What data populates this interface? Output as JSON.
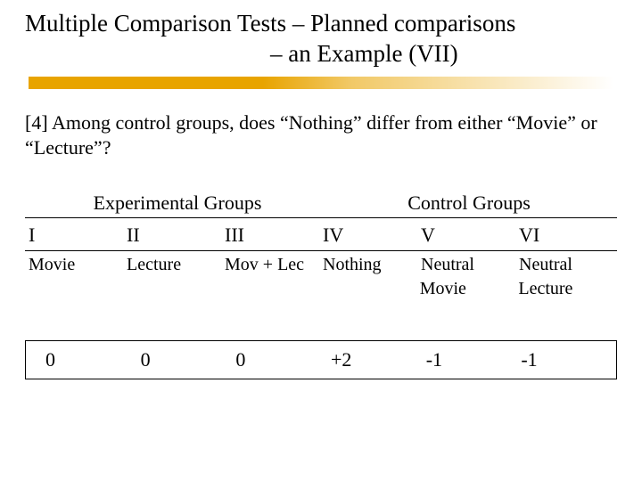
{
  "title": {
    "line1": "Multiple Comparison Tests – Planned comparisons",
    "line2": "– an Example (VII)"
  },
  "question": "[4] Among control groups, does “Nothing” differ from either “Movie” or “Lecture”?",
  "group_headers": {
    "experimental": "Experimental Groups",
    "control": "Control Groups"
  },
  "columns": [
    "I",
    "II",
    "III",
    "IV",
    "V",
    "VI"
  ],
  "labels_row1": [
    "Movie",
    "Lecture",
    "Mov + Lec",
    "Nothing",
    "Neutral",
    "Neutral"
  ],
  "labels_row2": [
    "",
    "",
    "",
    "",
    "Movie",
    "Lecture"
  ],
  "coefficients": [
    "0",
    "0",
    "0",
    "+2",
    "-1",
    "-1"
  ]
}
